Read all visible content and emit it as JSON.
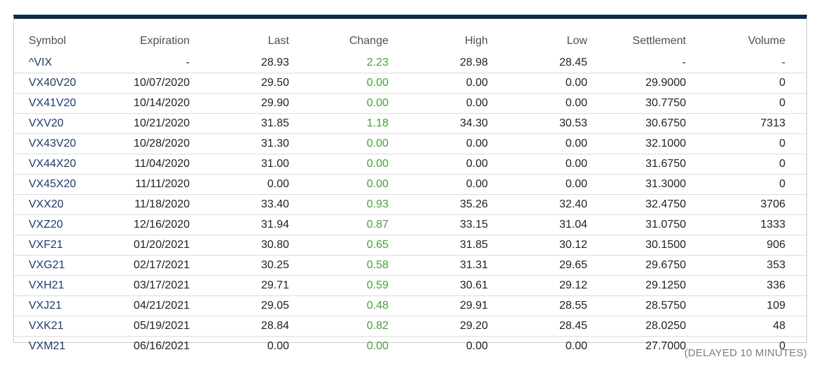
{
  "columns": {
    "symbol": "Symbol",
    "expiration": "Expiration",
    "last": "Last",
    "change": "Change",
    "high": "High",
    "low": "Low",
    "settlement": "Settlement",
    "volume": "Volume"
  },
  "colors": {
    "header_bar": "#0f2a4d",
    "symbol_text": "#1a3d6b",
    "change_text": "#44a037",
    "note_text": "#7d7d7d"
  },
  "rows": [
    {
      "symbol": "^VIX",
      "expiration": "-",
      "last": "28.93",
      "change": "2.23",
      "high": "28.98",
      "low": "28.45",
      "settlement": "-",
      "volume": "-"
    },
    {
      "symbol": "VX40V20",
      "expiration": "10/07/2020",
      "last": "29.50",
      "change": "0.00",
      "high": "0.00",
      "low": "0.00",
      "settlement": "29.9000",
      "volume": "0"
    },
    {
      "symbol": "VX41V20",
      "expiration": "10/14/2020",
      "last": "29.90",
      "change": "0.00",
      "high": "0.00",
      "low": "0.00",
      "settlement": "30.7750",
      "volume": "0"
    },
    {
      "symbol": "VXV20",
      "expiration": "10/21/2020",
      "last": "31.85",
      "change": "1.18",
      "high": "34.30",
      "low": "30.53",
      "settlement": "30.6750",
      "volume": "7313"
    },
    {
      "symbol": "VX43V20",
      "expiration": "10/28/2020",
      "last": "31.30",
      "change": "0.00",
      "high": "0.00",
      "low": "0.00",
      "settlement": "32.1000",
      "volume": "0"
    },
    {
      "symbol": "VX44X20",
      "expiration": "11/04/2020",
      "last": "31.00",
      "change": "0.00",
      "high": "0.00",
      "low": "0.00",
      "settlement": "31.6750",
      "volume": "0"
    },
    {
      "symbol": "VX45X20",
      "expiration": "11/11/2020",
      "last": "0.00",
      "change": "0.00",
      "high": "0.00",
      "low": "0.00",
      "settlement": "31.3000",
      "volume": "0"
    },
    {
      "symbol": "VXX20",
      "expiration": "11/18/2020",
      "last": "33.40",
      "change": "0.93",
      "high": "35.26",
      "low": "32.40",
      "settlement": "32.4750",
      "volume": "3706"
    },
    {
      "symbol": "VXZ20",
      "expiration": "12/16/2020",
      "last": "31.94",
      "change": "0.87",
      "high": "33.15",
      "low": "31.04",
      "settlement": "31.0750",
      "volume": "1333"
    },
    {
      "symbol": "VXF21",
      "expiration": "01/20/2021",
      "last": "30.80",
      "change": "0.65",
      "high": "31.85",
      "low": "30.12",
      "settlement": "30.1500",
      "volume": "906"
    },
    {
      "symbol": "VXG21",
      "expiration": "02/17/2021",
      "last": "30.25",
      "change": "0.58",
      "high": "31.31",
      "low": "29.65",
      "settlement": "29.6750",
      "volume": "353"
    },
    {
      "symbol": "VXH21",
      "expiration": "03/17/2021",
      "last": "29.71",
      "change": "0.59",
      "high": "30.61",
      "low": "29.12",
      "settlement": "29.1250",
      "volume": "336"
    },
    {
      "symbol": "VXJ21",
      "expiration": "04/21/2021",
      "last": "29.05",
      "change": "0.48",
      "high": "29.91",
      "low": "28.55",
      "settlement": "28.5750",
      "volume": "109"
    },
    {
      "symbol": "VXK21",
      "expiration": "05/19/2021",
      "last": "28.84",
      "change": "0.82",
      "high": "29.20",
      "low": "28.45",
      "settlement": "28.0250",
      "volume": "48"
    },
    {
      "symbol": "VXM21",
      "expiration": "06/16/2021",
      "last": "0.00",
      "change": "0.00",
      "high": "0.00",
      "low": "0.00",
      "settlement": "27.7000",
      "volume": "0"
    }
  ],
  "note": "(DELAYED 10 MINUTES)"
}
